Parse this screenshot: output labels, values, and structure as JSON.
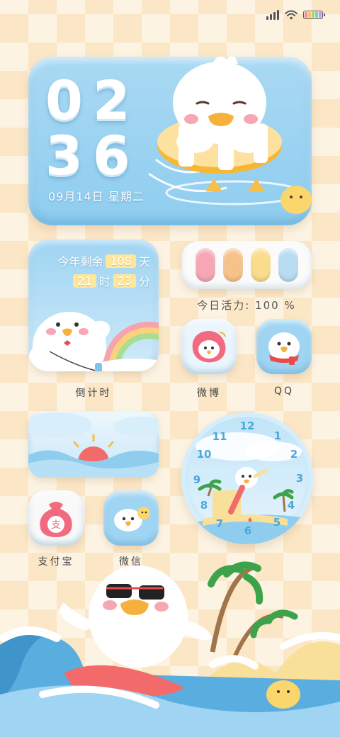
{
  "clock": {
    "hour": "02",
    "minute": "36",
    "date": "09月14日 星期二"
  },
  "countdown": {
    "line1_prefix": "今年剩余",
    "days": "108",
    "line1_suffix": "天",
    "hours": "21",
    "hours_unit": "时",
    "minutes": "23",
    "minutes_unit": "分",
    "label": "倒计时"
  },
  "vitality": {
    "label": "今日活力: 100 %",
    "pill_colors": [
      "#f6a6b4",
      "#f7c28a",
      "#f9dc8c",
      "#b8dcf2"
    ]
  },
  "apps": {
    "weibo": {
      "label": "微博",
      "icon": "weibo-icon"
    },
    "qq": {
      "label": "QQ",
      "icon": "qq-icon"
    },
    "alipay": {
      "label": "支付宝",
      "icon": "alipay-icon",
      "glyph": "支"
    },
    "wechat": {
      "label": "微信",
      "icon": "wechat-icon"
    }
  },
  "analog_clock": {
    "numbers": [
      "12",
      "1",
      "2",
      "3",
      "4",
      "5",
      "6",
      "7",
      "8",
      "9",
      "10",
      "11"
    ]
  },
  "colors": {
    "accent_blue": "#8fcdef",
    "background": "#fdf0dc"
  }
}
